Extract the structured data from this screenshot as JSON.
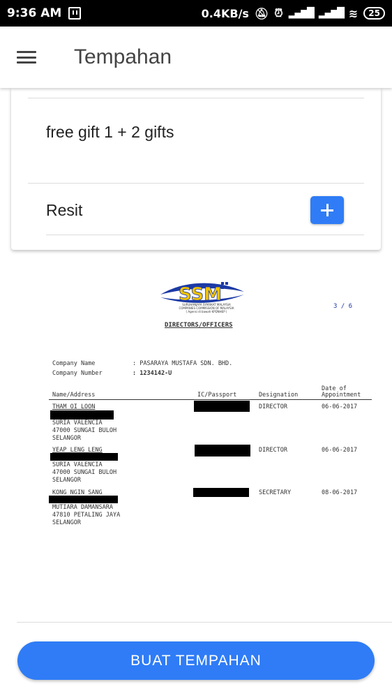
{
  "status_bar": {
    "time": "9:36 AM",
    "net_speed": "0.4KB/s",
    "battery": "25"
  },
  "app_bar": {
    "title": "Tempahan"
  },
  "card": {
    "note_text": "free gift 1 + 2 gifts",
    "resit_label": "Resit"
  },
  "document": {
    "logo_text": "SSM",
    "logo_caption_1": "SURUHANJAYA SYARIKAT MALAYSIA",
    "logo_caption_2": "COMPANIES COMMISSION OF MALAYSIA",
    "logo_caption_3": "( Agensi di bawah KPDNHEP )",
    "page_number": "3 / 6",
    "heading": "DIRECTORS/OFFICERS",
    "company_name_label": "Company Name",
    "company_name_value": ": PASARAYA MUSTAFA SDN. BHD.",
    "company_number_label": "Company Number",
    "company_number_value": ": 1234142-U",
    "columns": {
      "name": "Name/Address",
      "ic": "IC/Passport",
      "designation": "Designation",
      "date_line1": "Date of",
      "date_line2": "Appointment"
    },
    "officers": [
      {
        "name": "THAM OI LOON",
        "address": [
          "SURIA VALENCIA",
          "47000  SUNGAI BULOH",
          "SELANGOR"
        ],
        "designation": "DIRECTOR",
        "date": "06-06-2017"
      },
      {
        "name": "YEAP LENG LENG",
        "address": [
          "SURIA VALENCIA",
          "47000  SUNGAI BULOH",
          "SELANGOR"
        ],
        "designation": "DIRECTOR",
        "date": "06-06-2017"
      },
      {
        "name": "KONG NGIN SANG",
        "address": [
          "MUTIARA DAMANSARA",
          "47810  PETALING JAYA",
          "SELANGOR"
        ],
        "designation": "SECRETARY",
        "date": "08-06-2017"
      }
    ]
  },
  "footer": {
    "button_label": "BUAT TEMPAHAN"
  },
  "colors": {
    "accent": "#2f7cf6",
    "status_bar": "#000000",
    "logo_yellow": "#f2c300",
    "logo_navy": "#1c3aa6"
  }
}
